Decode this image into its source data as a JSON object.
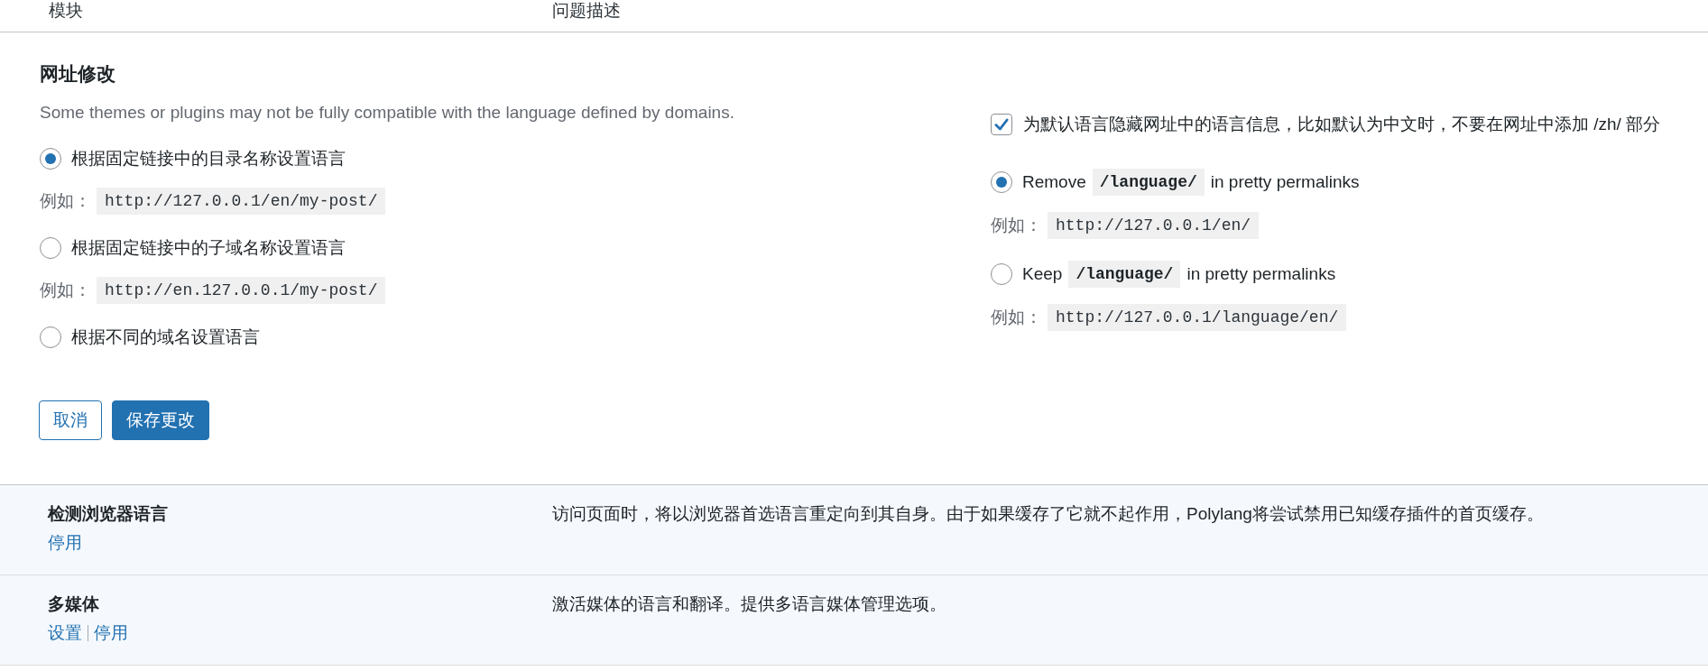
{
  "table": {
    "columns": [
      "模块",
      "问题描述"
    ]
  },
  "url_settings": {
    "title": "网址修改",
    "note": "Some themes or plugins may not be fully compatible with the language defined by domains.",
    "url_modes": [
      {
        "label": "根据固定链接中的目录名称设置语言",
        "selected": true,
        "example_label": "例如：",
        "example": "http://127.0.0.1/en/my-post/"
      },
      {
        "label": "根据固定链接中的子域名称设置语言",
        "selected": false,
        "example_label": "例如：",
        "example": "http://en.127.0.0.1/my-post/"
      },
      {
        "label": "根据不同的域名设置语言",
        "selected": false
      }
    ],
    "hide_default_language": {
      "label": "为默认语言隐藏网址中的语言信息，比如默认为中文时，不要在网址中添加 /zh/ 部分",
      "checked": true
    },
    "rewrite_options": [
      {
        "text_before": "Remove",
        "code": "/language/",
        "text_after": "in pretty permalinks",
        "selected": true,
        "example_label": "例如：",
        "example": "http://127.0.0.1/en/"
      },
      {
        "text_before": "Keep",
        "code": "/language/",
        "text_after": "in pretty permalinks",
        "selected": false,
        "example_label": "例如：",
        "example": "http://127.0.0.1/language/en/"
      }
    ],
    "buttons": [
      {
        "label": "取消",
        "kind": "secondary"
      },
      {
        "label": "保存更改",
        "kind": "primary"
      }
    ]
  },
  "modules": [
    {
      "name": "检测浏览器语言",
      "actions": [
        "停用"
      ],
      "description": "访问页面时，将以浏览器首选语言重定向到其自身。由于如果缓存了它就不起作用，Polylang将尝试禁用已知缓存插件的首页缓存。"
    },
    {
      "name": "多媒体",
      "actions": [
        "设置",
        "停用"
      ],
      "description": "激活媒体的语言和翻译。提供多语言媒体管理选项。"
    }
  ]
}
